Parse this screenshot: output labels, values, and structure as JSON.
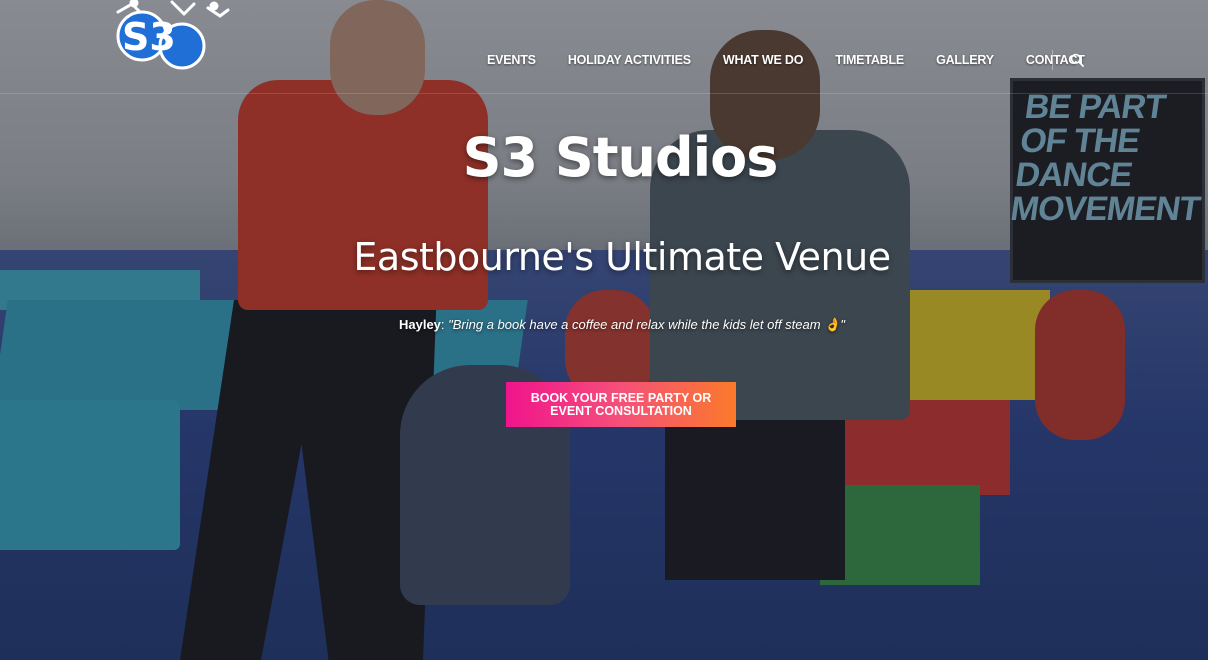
{
  "brand": {
    "logo_text": "S3"
  },
  "nav": {
    "items": [
      {
        "label": "EVENTS"
      },
      {
        "label": "HOLIDAY ACTIVITIES"
      },
      {
        "label": "WHAT WE DO"
      },
      {
        "label": "TIMETABLE"
      },
      {
        "label": "GALLERY"
      },
      {
        "label": "CONTACT"
      }
    ],
    "search_icon": "search-icon"
  },
  "hero": {
    "title": "S3 Studios",
    "subtitle": "Eastbourne's Ultimate Venue",
    "testimonial_author": "Hayley",
    "testimonial_quote": "\"Bring a book have a coffee and relax while the kids let off steam 👌\"",
    "cta_label": "BOOK YOUR FREE PARTY OR EVENT CONSULTATION",
    "poster_text": "BE PART OF THE DANCE MOVEMENT"
  },
  "colors": {
    "cta_start": "#f0148c",
    "cta_end": "#fb7a2a",
    "logo_blue": "#1f6fd6"
  }
}
